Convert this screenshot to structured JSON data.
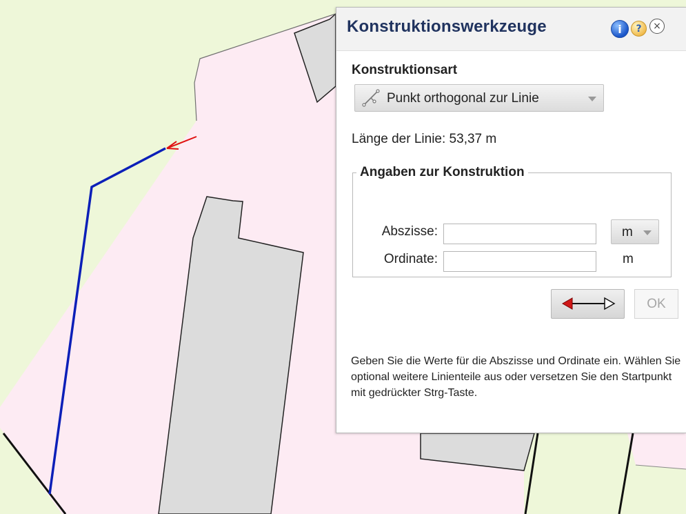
{
  "colors": {
    "map_green": "#eef7d9",
    "parcel_pink": "#fdebf3",
    "building_gray": "#dcdcdc",
    "selected_line": "#0b1fb8",
    "direction_arrow": "#e01010",
    "title_color": "#20335f"
  },
  "panel": {
    "title": "Konstruktionswerkzeuge",
    "icons": [
      "info-icon",
      "help-icon",
      "close-icon"
    ],
    "help_glyph": "?",
    "close_glyph": "×",
    "info_glyph": "i"
  },
  "konstruktion": {
    "label": "Konstruktionsart",
    "selected": "Punkt orthogonal zur Linie",
    "icon": "orthogonal-point-icon"
  },
  "length_text": "Länge der Linie: 53,37 m",
  "angaben": {
    "legend": "Angaben zur Konstruktion",
    "abszisse_label": "Abszisse:",
    "abszisse_value": "",
    "abszisse_unit": "m",
    "ordinate_label": "Ordinate:",
    "ordinate_value": "",
    "ordinate_unit": "m"
  },
  "buttons": {
    "direction_icon": "double-arrow-icon",
    "ok": "OK"
  },
  "hint": "Geben Sie die Werte für die Abszisse und Ordinate ein. Wählen Sie optional weitere Linienteile aus oder versetzen Sie den Startpunkt mit gedrückter Strg-Taste."
}
